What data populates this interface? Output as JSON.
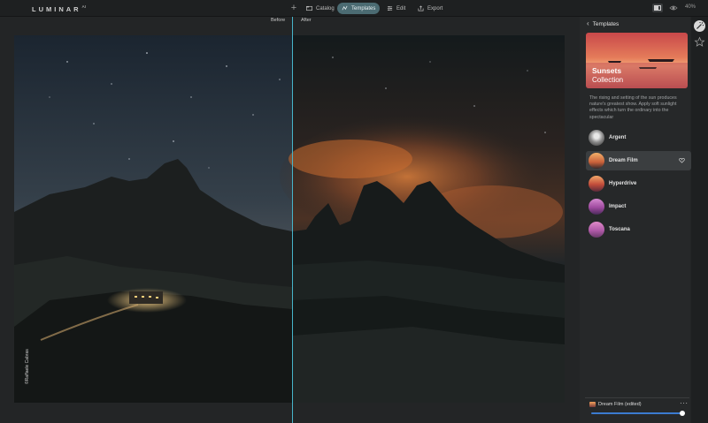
{
  "app": {
    "logo": "LUMINAR",
    "logo_suffix": "AI",
    "zoom": "40%"
  },
  "nav": {
    "catalog": "Catalog",
    "templates": "Templates",
    "edit": "Edit",
    "export": "Export"
  },
  "canvas": {
    "before_label": "Before",
    "after_label": "After",
    "watermark": "©Raffaele Cabras"
  },
  "panel": {
    "title": "Templates",
    "collection_title": "Sunsets",
    "collection_subtitle": "Collection",
    "description": "The rising and setting of the sun produces nature's greatest show. Apply soft sunlight effects which turn the ordinary into the spectacular",
    "templates": [
      {
        "name": "Argent",
        "active": false
      },
      {
        "name": "Dream Film",
        "active": true
      },
      {
        "name": "Hyperdrive",
        "active": false
      },
      {
        "name": "Impact",
        "active": false
      },
      {
        "name": "Toscana",
        "active": false
      }
    ],
    "applied_label": "Dream Film (edited)",
    "applied_amount": 1.0
  },
  "colors": {
    "accent": "#47b4c9",
    "active_tab": "#4b6b72",
    "slider": "#3b7bd0"
  },
  "icons": [
    "plus-icon",
    "catalog-icon",
    "templates-icon",
    "edit-icon",
    "export-icon",
    "compare-icon",
    "eye-icon",
    "chevron-left-icon",
    "heart-icon",
    "magic-wand-icon",
    "star-icon",
    "more-icon"
  ]
}
